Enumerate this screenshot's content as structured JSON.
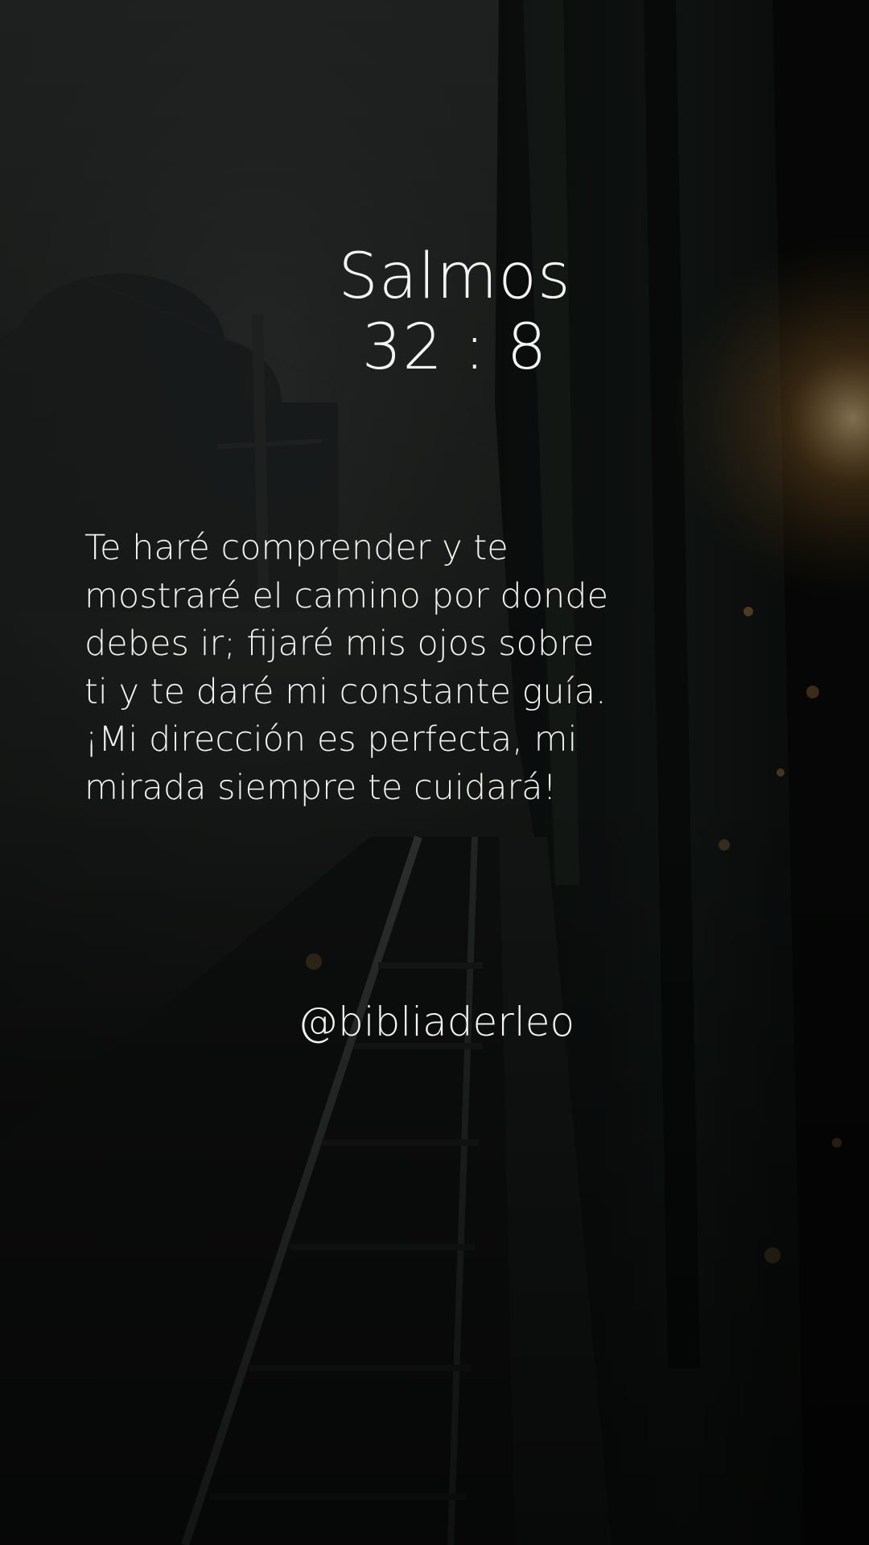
{
  "reference": {
    "book": "Salmos",
    "chapter_verse": "32 : 8"
  },
  "verse_lines": [
    "Te haré comprender y te",
    "mostraré el camino por donde",
    "debes ir; fijaré mis ojos sobre",
    "ti y te daré mi constante guía.",
    "¡Mi dirección es perfecta, mi",
    "mirada siempre te cuidará!"
  ],
  "handle": "@bibliaderleo",
  "colors": {
    "text": "#f4f4f2",
    "background_dark": "#0c0d0d",
    "lamp_glow": "#e0a24a"
  }
}
